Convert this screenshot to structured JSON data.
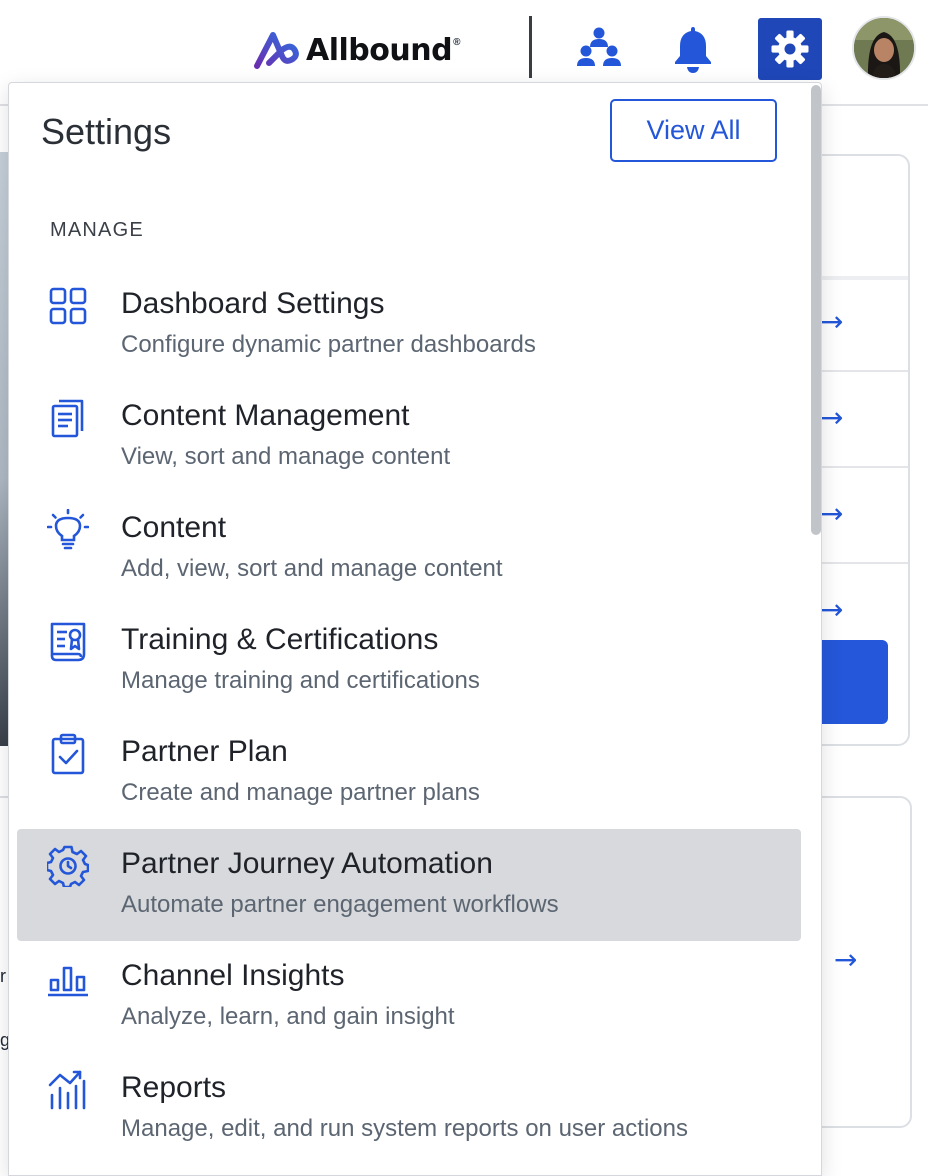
{
  "header": {
    "brand": "Allbound",
    "brand_mark": "®",
    "icons": {
      "org": "org-chart-icon",
      "notifications": "bell-icon",
      "settings": "gear-icon"
    },
    "accent_color": "#1f47b8"
  },
  "settings_panel": {
    "title": "Settings",
    "view_all_label": "View All",
    "section_label": "MANAGE",
    "items": [
      {
        "icon": "grid-icon",
        "title": "Dashboard Settings",
        "description": "Configure dynamic partner dashboards",
        "active": false
      },
      {
        "icon": "document-icon",
        "title": "Content Management",
        "description": "View, sort and manage content",
        "active": false
      },
      {
        "icon": "lightbulb-icon",
        "title": "Content",
        "description": "Add, view, sort and manage content",
        "active": false
      },
      {
        "icon": "certificate-icon",
        "title": "Training & Certifications",
        "description": "Manage training and certifications",
        "active": false
      },
      {
        "icon": "clipboard-check-icon",
        "title": "Partner Plan",
        "description": "Create and manage partner plans",
        "active": false
      },
      {
        "icon": "gear-clock-icon",
        "title": "Partner Journey Automation",
        "description": "Automate partner engagement workflows",
        "active": true
      },
      {
        "icon": "bar-chart-icon",
        "title": "Channel Insights",
        "description": "Analyze, learn, and gain insight",
        "active": false
      },
      {
        "icon": "line-chart-icon",
        "title": "Reports",
        "description": "Manage, edit, and run system reports on user actions",
        "active": false
      }
    ]
  },
  "background": {
    "arrow_glyph": "→",
    "left_fragments": [
      "r",
      "g"
    ]
  }
}
